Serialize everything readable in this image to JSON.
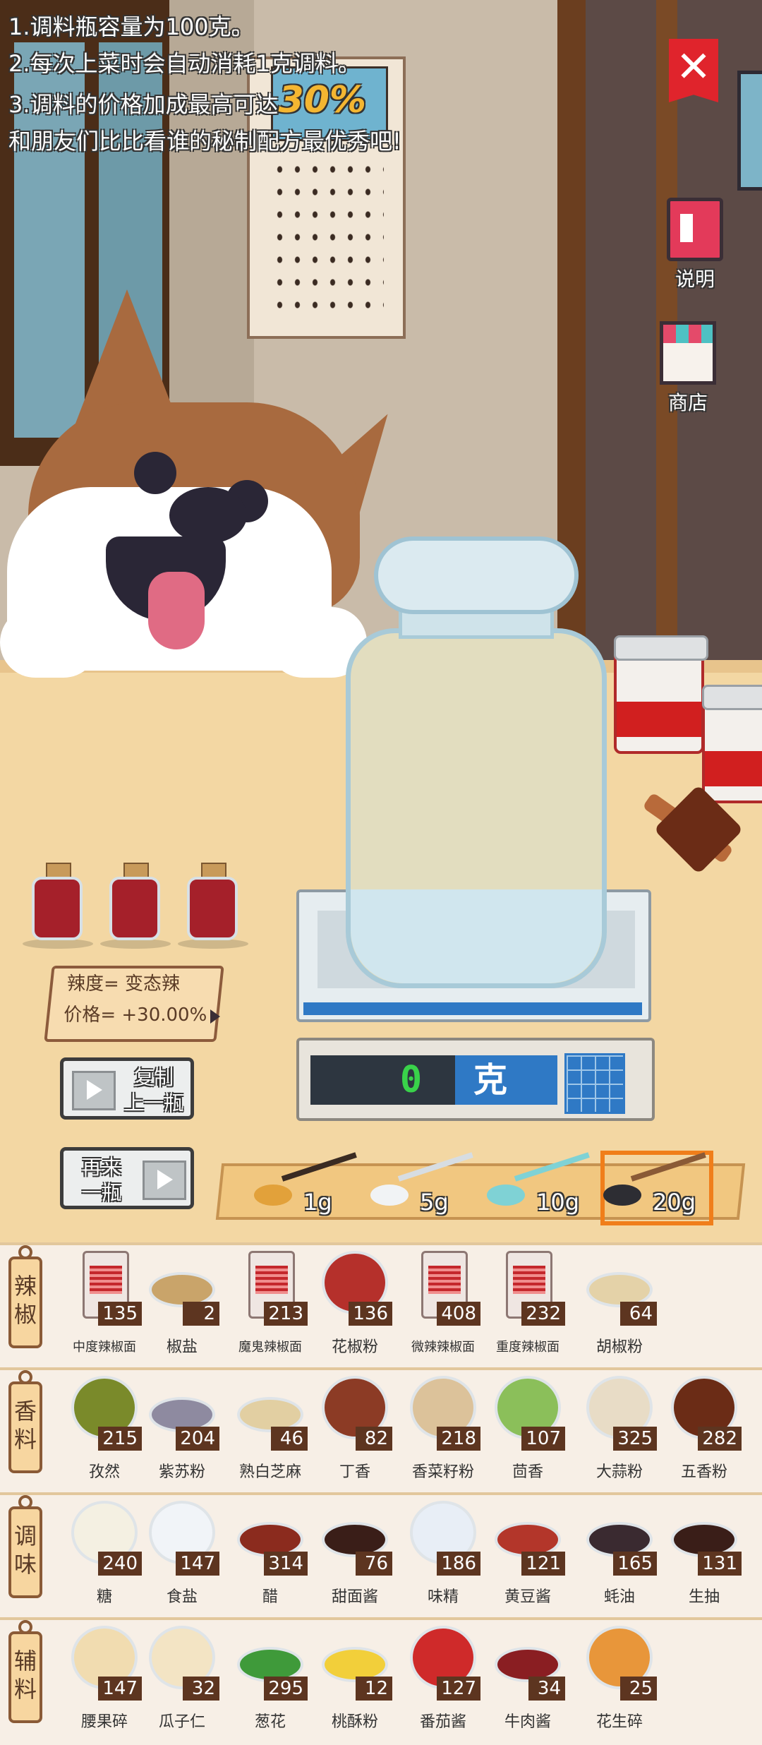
{
  "info": {
    "line1": "1.调料瓶容量为100克。",
    "line2": "2.每次上菜时会自动消耗1克调料。",
    "line3_prefix": "3.调料的价格加成最高可达",
    "line3_highlight": "30%",
    "line4": "和朋友们比比看谁的秘制配方最优秀吧!"
  },
  "close_label": "✕",
  "side": {
    "help_label": "说明",
    "shop_label": "商店"
  },
  "stats": {
    "spicy": "辣度= 变态辣",
    "price": "价格= +30.00%"
  },
  "actions": {
    "copy_label_1": "复制",
    "copy_label_2": "上一瓶",
    "again_label_1": "再来",
    "again_label_2": "一瓶"
  },
  "scale": {
    "value": "0",
    "unit": "克"
  },
  "spoons": [
    {
      "amount": "1g",
      "head_color": "#e2a13a",
      "handle_color": "#3a2b22",
      "selected": false
    },
    {
      "amount": "5g",
      "head_color": "#f1f3f5",
      "handle_color": "#d7dde2",
      "selected": false
    },
    {
      "amount": "10g",
      "head_color": "#7fd2d5",
      "handle_color": "#7fd2d5",
      "selected": false
    },
    {
      "amount": "20g",
      "head_color": "#2d2d33",
      "handle_color": "#8a5a36",
      "selected": true
    }
  ],
  "categories": [
    {
      "label": "辣椒",
      "items": [
        {
          "name": "中度辣椒面",
          "count": "135",
          "icon": "can-icon"
        },
        {
          "name": "椒盐",
          "count": "2",
          "icon": "dish-icon",
          "color": "#c9a46a"
        },
        {
          "name": "魔鬼辣椒面",
          "count": "213",
          "icon": "can-icon"
        },
        {
          "name": "花椒粉",
          "count": "136",
          "icon": "peppercorn-icon",
          "color": "#b5302b"
        },
        {
          "name": "微辣辣椒面",
          "count": "408",
          "icon": "can-icon"
        },
        {
          "name": "重度辣椒面",
          "count": "232",
          "icon": "can-icon"
        },
        {
          "name": "胡椒粉",
          "count": "64",
          "icon": "dish-icon",
          "color": "#e4d2a8"
        }
      ]
    },
    {
      "label": "香料",
      "items": [
        {
          "name": "孜然",
          "count": "215",
          "icon": "cumin-icon",
          "color": "#7a8a2a"
        },
        {
          "name": "紫苏粉",
          "count": "204",
          "icon": "dish-icon",
          "color": "#8e8aa0"
        },
        {
          "name": "熟白芝麻",
          "count": "46",
          "icon": "dish-icon",
          "color": "#e2cfa2"
        },
        {
          "name": "丁香",
          "count": "82",
          "icon": "clove-icon",
          "color": "#8c3b25"
        },
        {
          "name": "香菜籽粉",
          "count": "218",
          "icon": "seed-icon",
          "color": "#dcc29a"
        },
        {
          "name": "茴香",
          "count": "107",
          "icon": "fennel-icon",
          "color": "#8bbf5a"
        },
        {
          "name": "大蒜粉",
          "count": "325",
          "icon": "garlic-icon",
          "color": "#e8dcc6"
        },
        {
          "name": "五香粉",
          "count": "282",
          "icon": "star-anise-icon",
          "color": "#6b2c16"
        }
      ]
    },
    {
      "label": "调味",
      "items": [
        {
          "name": "糖",
          "count": "240",
          "icon": "sugar-icon",
          "color": "#f4f0e2"
        },
        {
          "name": "食盐",
          "count": "147",
          "icon": "salt-bag-icon",
          "color": "#f1f4f8"
        },
        {
          "name": "醋",
          "count": "314",
          "icon": "dish-icon",
          "color": "#8b2b1e"
        },
        {
          "name": "甜面酱",
          "count": "76",
          "icon": "dish-icon",
          "color": "#3a1e18"
        },
        {
          "name": "味精",
          "count": "186",
          "icon": "msg-bag-icon",
          "color": "#e8eef6"
        },
        {
          "name": "黄豆酱",
          "count": "121",
          "icon": "dish-icon",
          "color": "#b3362a"
        },
        {
          "name": "蚝油",
          "count": "165",
          "icon": "dish-icon",
          "color": "#3a2a30"
        },
        {
          "name": "生抽",
          "count": "131",
          "icon": "dish-icon",
          "color": "#3a1e18"
        }
      ]
    },
    {
      "label": "辅料",
      "items": [
        {
          "name": "腰果碎",
          "count": "147",
          "icon": "cashew-icon",
          "color": "#f1dcb0"
        },
        {
          "name": "瓜子仁",
          "count": "32",
          "icon": "seed-icon",
          "color": "#f3e4c4"
        },
        {
          "name": "葱花",
          "count": "295",
          "icon": "dish-icon",
          "color": "#3f9a3a"
        },
        {
          "name": "桃酥粉",
          "count": "12",
          "icon": "dish-icon",
          "color": "#f2cf3a"
        },
        {
          "name": "番茄酱",
          "count": "127",
          "icon": "jar-icon",
          "color": "#cf2a2a"
        },
        {
          "name": "牛肉酱",
          "count": "34",
          "icon": "dish-icon",
          "color": "#8a1e22"
        },
        {
          "name": "花生碎",
          "count": "25",
          "icon": "peanut-icon",
          "color": "#e8963a"
        }
      ]
    }
  ]
}
